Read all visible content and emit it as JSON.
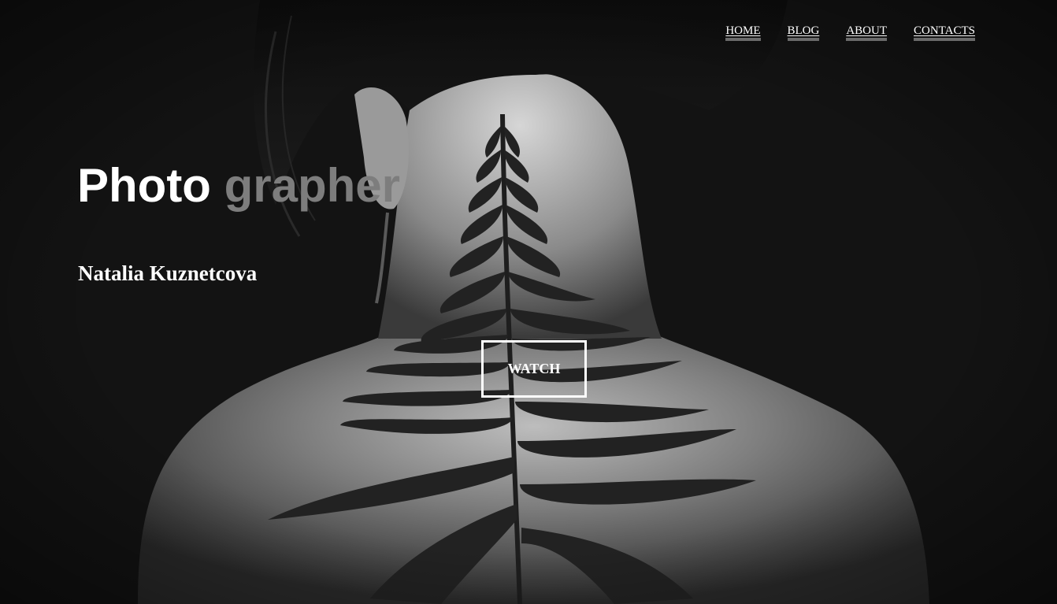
{
  "nav": {
    "items": [
      {
        "label": "HOME"
      },
      {
        "label": "BLOG"
      },
      {
        "label": "ABOUT"
      },
      {
        "label": "CONTACTS"
      }
    ]
  },
  "hero": {
    "title_word1": "Photo",
    "title_word2": "grapher",
    "subtitle": "Natalia Kuznetcova",
    "cta_label": "WATCH",
    "image_icon": "woman-back-with-fern-photo"
  },
  "colors": {
    "background": "#121212",
    "title_primary": "#ffffff",
    "title_secondary": "#7d7d7d",
    "nav_underline": "#6b6b6b"
  }
}
